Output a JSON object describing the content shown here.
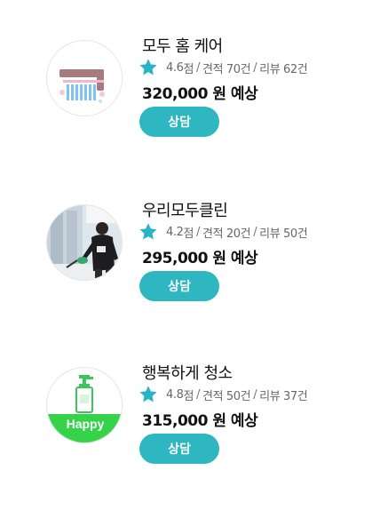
{
  "colors": {
    "accent": "#2fb7c1",
    "star": "#28b4c6",
    "happy_band": "#36d24a"
  },
  "providers": [
    {
      "name": "모두 홈 케어",
      "rating": "4.6",
      "rating_unit": "점",
      "estimates": "견적 70건",
      "reviews": "리뷰 62건",
      "price": "320,000 원 예상",
      "button": "상담",
      "avatar_icon": "faucet-cleaning-icon"
    },
    {
      "name": "우리모두클린",
      "rating": "4.2",
      "rating_unit": "점",
      "estimates": "견적 20건",
      "reviews": "리뷰 50건",
      "price": "295,000 원 예상",
      "button": "상담",
      "avatar_icon": "cleaner-worker-photo"
    },
    {
      "name": "행복하게 청소",
      "rating": "4.8",
      "rating_unit": "점",
      "estimates": "견적 50건",
      "reviews": "리뷰 37건",
      "price": "315,000 원 예상",
      "button": "상담",
      "avatar_icon": "soap-dispenser-icon",
      "avatar_label": "Happy"
    }
  ]
}
